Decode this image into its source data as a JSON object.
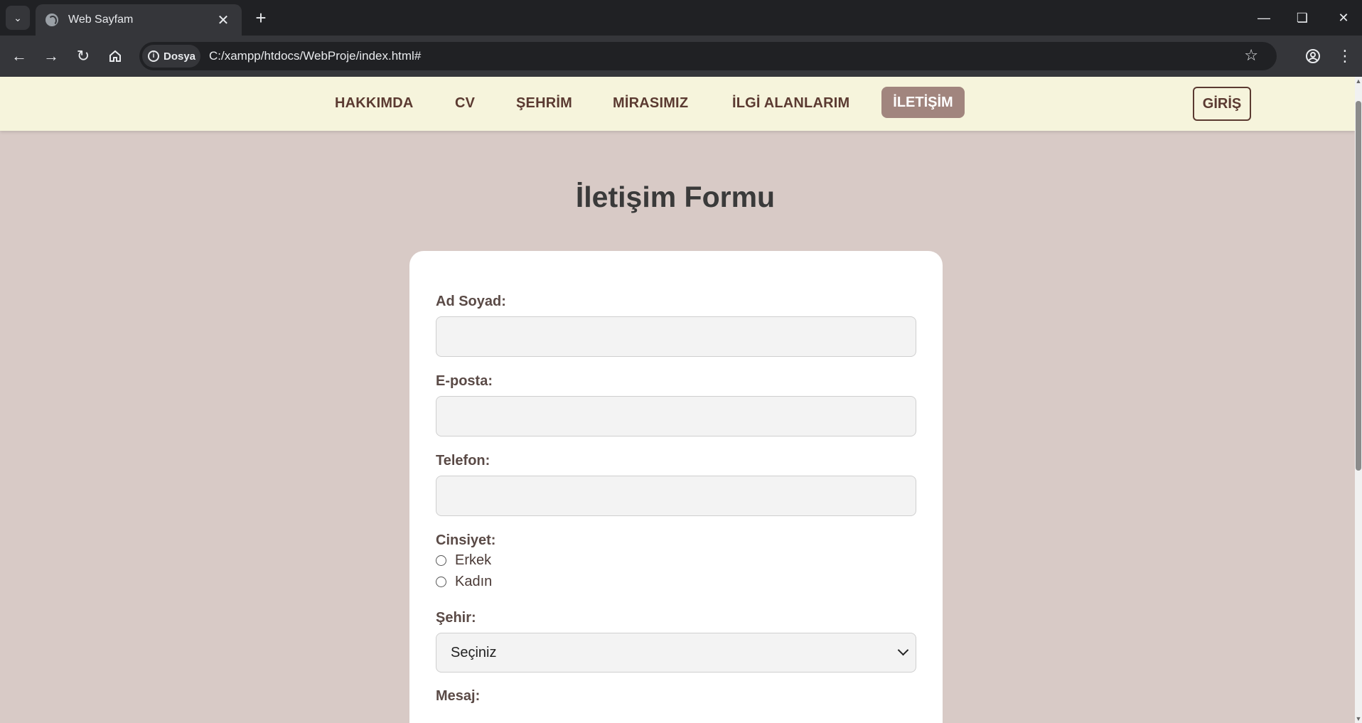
{
  "browser": {
    "tab_title": "Web Sayfam",
    "site_chip": "Dosya",
    "url": "C:/xampp/htdocs/WebProje/index.html#"
  },
  "nav": {
    "items": [
      "HAKKIMDA",
      "CV",
      "ŞEHRİM",
      "MİRASIMIZ",
      "İLGİ ALANLARIM"
    ],
    "active": "İLETİŞİM",
    "login": "GİRİŞ"
  },
  "form": {
    "title": "İletişim Formu",
    "name_label": "Ad Soyad:",
    "name_value": "",
    "email_label": "E-posta:",
    "email_value": "",
    "phone_label": "Telefon:",
    "phone_value": "",
    "gender_label": "Cinsiyet:",
    "gender_options": [
      "Erkek",
      "Kadın"
    ],
    "city_label": "Şehir:",
    "city_selected": "Seçiniz",
    "message_label": "Mesaj:"
  },
  "colors": {
    "page_bg": "#d8cac6",
    "navbar_bg": "#f6f4dc",
    "brand_brown": "#5b3a31",
    "active_bg": "#a1857e"
  }
}
